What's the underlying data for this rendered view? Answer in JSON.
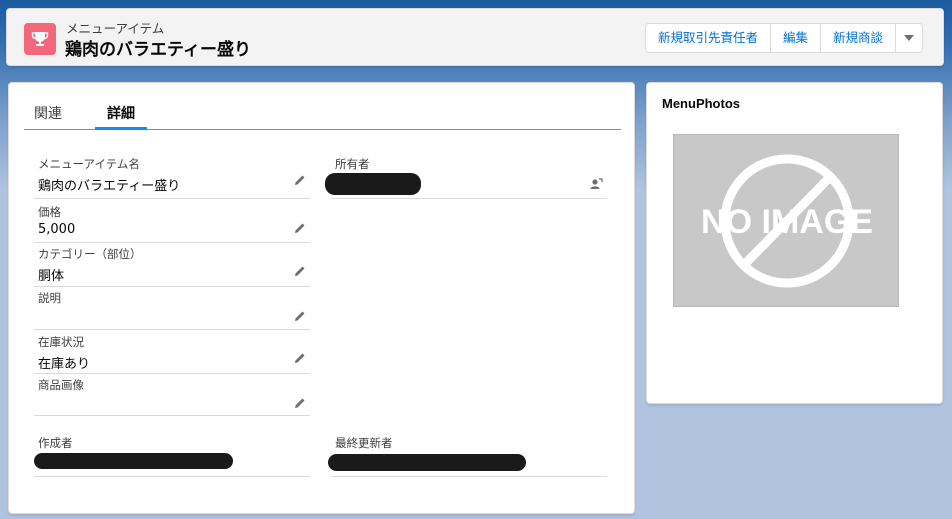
{
  "header": {
    "object_type": "メニューアイテム",
    "record_title": "鶏肉のバラエティー盛り",
    "buttons": [
      "新規取引先責任者",
      "編集",
      "新規商談"
    ],
    "icon": "trophy-icon"
  },
  "tabs": [
    {
      "label": "関連",
      "active": false
    },
    {
      "label": "詳細",
      "active": true
    }
  ],
  "fields": {
    "menu_item_name": {
      "label": "メニューアイテム名",
      "value": "鶏肉のバラエティー盛り"
    },
    "owner": {
      "label": "所有者",
      "value": ""
    },
    "price": {
      "label": "価格",
      "value": "5,000"
    },
    "category": {
      "label": "カテゴリー（部位）",
      "value": "胴体"
    },
    "description": {
      "label": "説明",
      "value": ""
    },
    "stock_status": {
      "label": "在庫状況",
      "value": "在庫あり"
    },
    "product_image": {
      "label": "商品画像",
      "value": ""
    },
    "created_by": {
      "label": "作成者",
      "value": ""
    },
    "last_modified_by": {
      "label": "最終更新者",
      "value": ""
    }
  },
  "side_panel": {
    "title": "MenuPhotos",
    "placeholder_text": "NO IMAGE"
  },
  "colors": {
    "object_icon": "#f2677c",
    "tab_active": "#1589ee",
    "button_text": "#0070d2"
  }
}
